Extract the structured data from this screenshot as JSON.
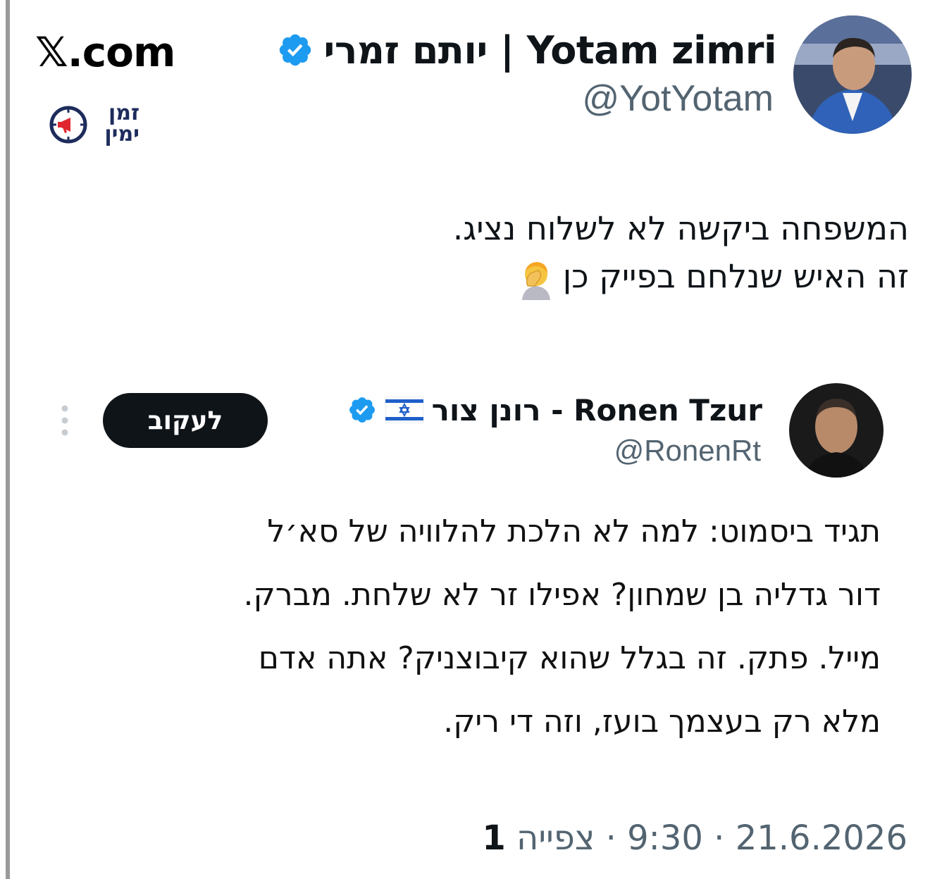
{
  "header": {
    "brand": "𝕏.com",
    "logo_text_line1": "זמן",
    "logo_text_line2": "ימין"
  },
  "author": {
    "display_name": "יותם זמרי | Yotam zimri",
    "handle": "@YotYotam",
    "verified": true
  },
  "tweet": {
    "line1": "המשפחה ביקשה לא לשלוח נציג.",
    "line2": "זה האיש שנלחם בפייק כן",
    "emoji": "facepalm-icon"
  },
  "quoted": {
    "display_name": "רונן צור - Ronen Tzur",
    "handle": "@RonenRt",
    "verified": true,
    "follow_label": "לעקוב",
    "lines": [
      "תגיד ביסמוט: למה לא הלכת להלוויה של סא׳ל",
      "דור גדליה בן שמחון? אפילו זר לא שלחת. מברק.",
      "מייל. פתק. זה בגלל שהוא קיבוצניק? אתה אדם",
      "מלא רק בעצמך בועז, וזה די ריק."
    ]
  },
  "meta": {
    "date": "21.6.2026",
    "time": "9:30",
    "separator": "·",
    "views_label": "צפייה",
    "views_count": "1"
  },
  "colors": {
    "verified_blue": "#1d9bf0",
    "follow_bg": "#0f1419",
    "secondary_text": "#536471"
  }
}
